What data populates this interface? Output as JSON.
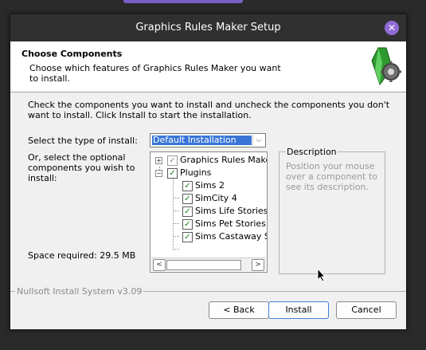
{
  "window": {
    "title": "Graphics Rules Maker Setup",
    "close_glyph": "✕"
  },
  "header": {
    "title": "Choose Components",
    "subtitle": "Choose which features of Graphics Rules Maker you want to install.",
    "logo_icon": "installer-logo-icon"
  },
  "intro": "Check the components you want to install and uncheck the components you don't want to install. Click Install to start the installation.",
  "install_type": {
    "label": "Select the type of install:",
    "selected": "Default Installation",
    "arrow_glyph": "⌵"
  },
  "optional_label": "Or, select the optional components you wish to install:",
  "tree": [
    {
      "label": "Graphics Rules Maker",
      "checked": true,
      "greyed": true,
      "expander": "+"
    },
    {
      "label": "Plugins",
      "checked": true,
      "greyed": false,
      "expander": "−"
    },
    {
      "label": "Sims 2",
      "checked": true
    },
    {
      "label": "SimCity 4",
      "checked": true
    },
    {
      "label": "Sims Life Stories",
      "checked": true
    },
    {
      "label": "Sims Pet Stories",
      "checked": true
    },
    {
      "label": "Sims Castaway Stories",
      "checked": true
    }
  ],
  "scroll": {
    "left_glyph": "<",
    "right_glyph": ">"
  },
  "space_required": "Space required: 29.5 MB",
  "description": {
    "legend": "Description",
    "text": "Position your mouse over a component to see its description."
  },
  "branding": "Nullsoft Install System v3.09",
  "buttons": {
    "back": "< Back",
    "install": "Install",
    "cancel": "Cancel"
  },
  "check_glyph": "✓",
  "colors": {
    "accent": "#8e6ad6",
    "selection": "#3875d7",
    "check": "#1a7d1a"
  }
}
